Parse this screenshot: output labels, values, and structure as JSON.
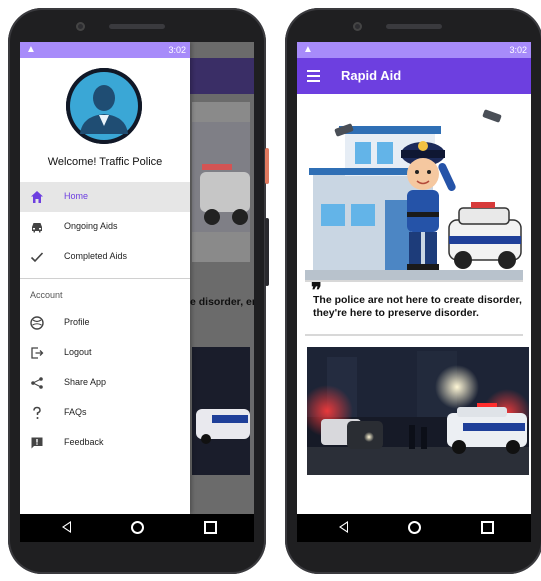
{
  "status": {
    "time": "3:02"
  },
  "app": {
    "title": "Rapid Aid"
  },
  "drawer": {
    "welcome": "Welcome! Traffic Police",
    "primary_items": [
      {
        "label": "Home",
        "icon": "home-icon",
        "active": true
      },
      {
        "label": "Ongoing Aids",
        "icon": "car-icon"
      },
      {
        "label": "Completed Aids",
        "icon": "check-icon"
      }
    ],
    "section_header": "Account",
    "account_items": [
      {
        "label": "Profile",
        "icon": "profile-icon"
      },
      {
        "label": "Logout",
        "icon": "logout-icon"
      },
      {
        "label": "Share App",
        "icon": "share-icon"
      },
      {
        "label": "FAQs",
        "icon": "help-icon"
      },
      {
        "label": "Feedback",
        "icon": "feedback-icon"
      }
    ],
    "behind_text": "e disorder, er."
  },
  "home": {
    "quote": "The police are not here to create disorder, they're here to preserve disorder."
  },
  "colors": {
    "accent": "#6d3fe0",
    "status_bar": "#a78bfa",
    "active_item_bg": "#e6e6e6"
  }
}
